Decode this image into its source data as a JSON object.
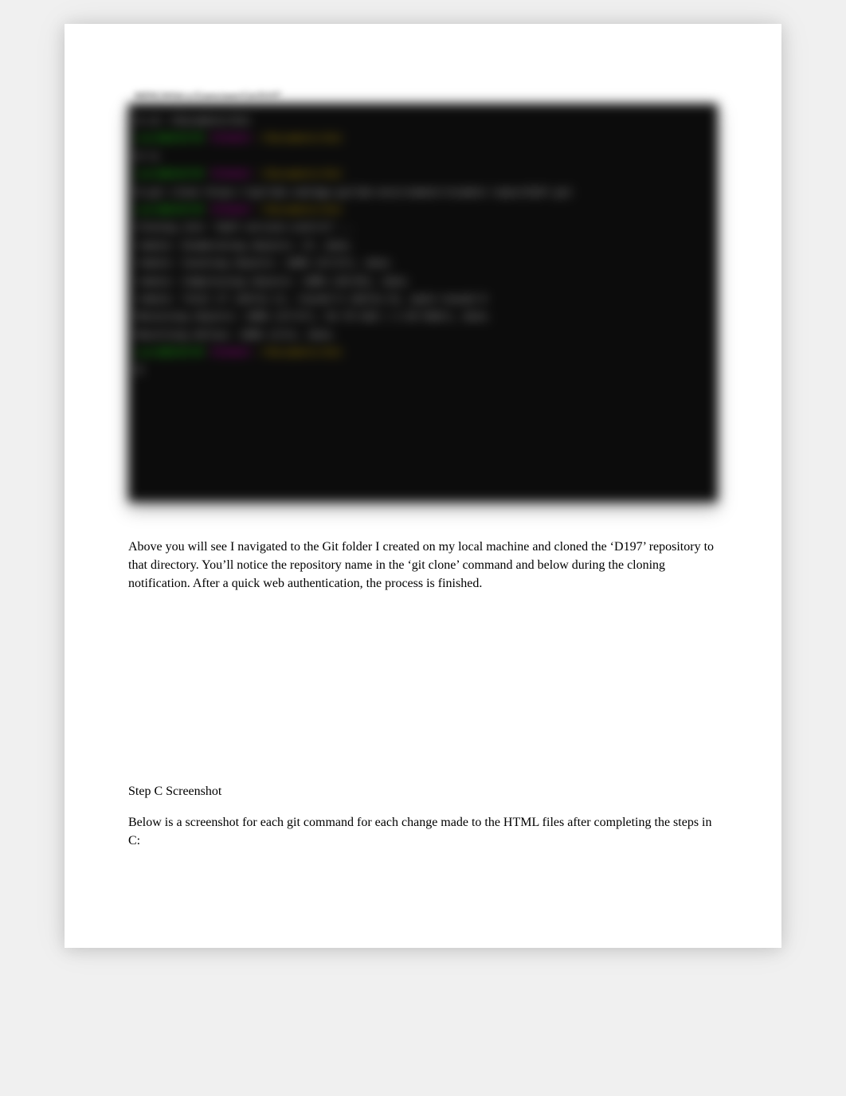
{
  "terminal": {
    "window_title": "MINGW64:/c/Users/user/Git/D197",
    "lines": [
      {
        "segments": [
          {
            "cls": "white",
            "text": "$ cd ~/Documents/Git"
          }
        ]
      },
      {
        "segments": [
          {
            "cls": "green",
            "text": "user@DESKTOP "
          },
          {
            "cls": "purple",
            "text": "MINGW64 "
          },
          {
            "cls": "yellow",
            "text": "~/Documents/Git"
          }
        ]
      },
      {
        "segments": [
          {
            "cls": "white",
            "text": "$ ls"
          }
        ]
      },
      {
        "segments": [
          {
            "cls": "green",
            "text": "user@DESKTOP "
          },
          {
            "cls": "purple",
            "text": "MINGW64 "
          },
          {
            "cls": "yellow",
            "text": "~/Documents/Git"
          }
        ]
      },
      {
        "segments": [
          {
            "cls": "white",
            "text": "$ git clone https://gitlab.com/wgu-gitlab-environment/student-repos/D197.git"
          }
        ]
      },
      {
        "segments": [
          {
            "cls": "green",
            "text": "user@DESKTOP "
          },
          {
            "cls": "purple",
            "text": "MINGW64 "
          },
          {
            "cls": "yellow",
            "text": "~/Documents/Git"
          }
        ]
      },
      {
        "segments": [
          {
            "cls": "white",
            "text": "Cloning into 'd197-version-control'..."
          }
        ]
      },
      {
        "segments": [
          {
            "cls": "white",
            "text": "remote: Enumerating objects: 27, done."
          }
        ]
      },
      {
        "segments": [
          {
            "cls": "white",
            "text": "remote: Counting objects: 100% (27/27), done."
          }
        ]
      },
      {
        "segments": [
          {
            "cls": "white",
            "text": "remote: Compressing objects: 100% (25/25), done."
          }
        ]
      },
      {
        "segments": [
          {
            "cls": "white",
            "text": "remote: Total 27 (delta 2), reused 0 (delta 0), pack-reused 0"
          }
        ]
      },
      {
        "segments": [
          {
            "cls": "white",
            "text": "Receiving objects: 100% (27/27), 54.76 KiB | 2.49 MiB/s, done."
          }
        ]
      },
      {
        "segments": [
          {
            "cls": "white",
            "text": "Resolving deltas: 100% (2/2), done."
          }
        ]
      },
      {
        "segments": [
          {
            "cls": "green",
            "text": "user@DESKTOP "
          },
          {
            "cls": "purple",
            "text": "MINGW64 "
          },
          {
            "cls": "yellow",
            "text": "~/Documents/Git"
          }
        ]
      },
      {
        "segments": [
          {
            "cls": "white",
            "text": "$"
          }
        ]
      }
    ]
  },
  "paragraphs": {
    "after_terminal": "Above you will see I navigated to the Git folder I created on my local machine and cloned the ‘D197’ repository to that directory. You’ll notice the repository name in the ‘git clone’ command and below during the cloning notification. After a quick web authentication, the process is finished.",
    "step_c_heading": "Step C Screenshot",
    "step_c_body": "Below is a screenshot for each git command for each change made to the HTML files after completing the steps in C:"
  }
}
